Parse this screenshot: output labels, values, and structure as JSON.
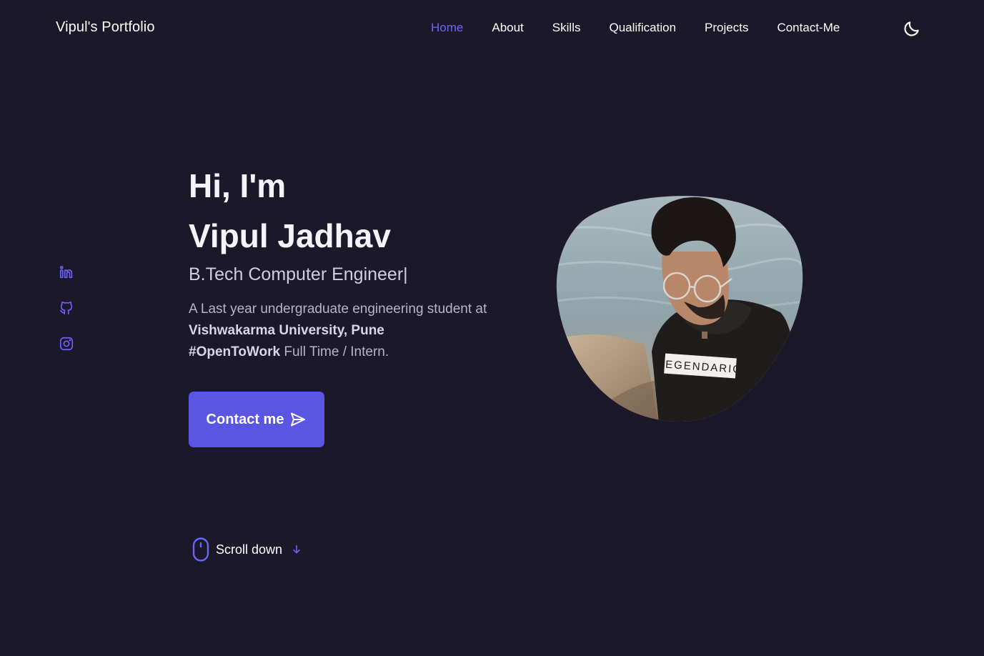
{
  "header": {
    "logo": "Vipul's Portfolio",
    "nav": [
      {
        "label": "Home",
        "active": true
      },
      {
        "label": "About",
        "active": false
      },
      {
        "label": "Skills",
        "active": false
      },
      {
        "label": "Qualification",
        "active": false
      },
      {
        "label": "Projects",
        "active": false
      },
      {
        "label": "Contact-Me",
        "active": false
      }
    ],
    "theme_icon": "moon-icon"
  },
  "social": {
    "icons": [
      "linkedin-icon",
      "github-icon",
      "instagram-icon"
    ]
  },
  "hero": {
    "greeting": "Hi, I'm",
    "name": "Vipul Jadhav",
    "role": "B.Tech Computer Engineer",
    "role_caret": "|",
    "desc_part1": "A Last year undergraduate engineering student at ",
    "desc_bold1": "Vishwakarma University, Pune",
    "desc_bold2": "#OpenToWork",
    "desc_part2": " Full Time / Intern.",
    "shirt_text": "LEGENDARIO",
    "contact_button": "Contact me",
    "scroll_label": "Scroll down"
  },
  "colors": {
    "background": "#1a1829",
    "accent": "#5a55e3",
    "active_nav": "#6c63ff"
  }
}
